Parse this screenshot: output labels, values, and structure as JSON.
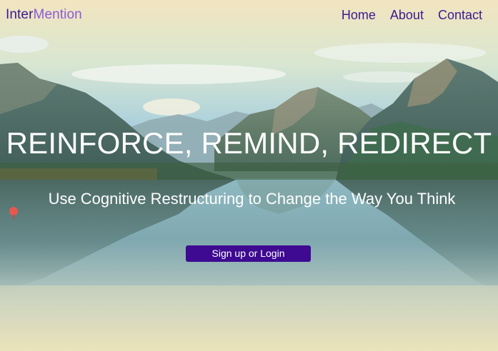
{
  "brand": {
    "logo_part_1": "Inter",
    "logo_part_2": "Mention"
  },
  "nav": {
    "items": [
      {
        "label": "Home"
      },
      {
        "label": "About"
      },
      {
        "label": "Contact"
      }
    ]
  },
  "hero": {
    "headline": "REINFORCE, REMIND, REDIRECT",
    "subheadline": "Use Cognitive Restructuring to Change the Way You Think",
    "cta_label": "Sign up or Login"
  },
  "colors": {
    "brand_primary": "#3b1b8f",
    "brand_accent": "#8c5ad8",
    "button_bg": "#3d0a91",
    "hero_text": "#ffffff"
  }
}
